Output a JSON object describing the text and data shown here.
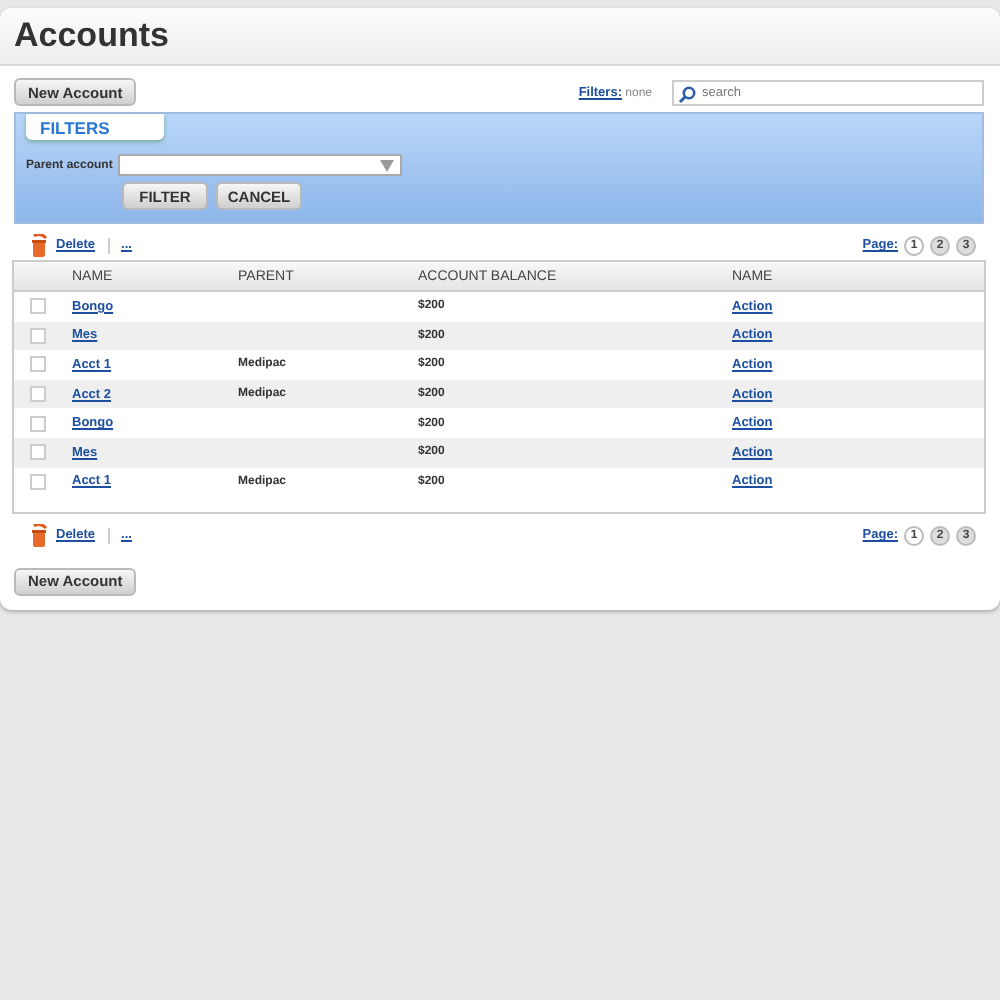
{
  "title": "Accounts",
  "new_account_button": "New Account",
  "filters_summary": {
    "label": "Filters:",
    "value": "none"
  },
  "search": {
    "placeholder": "search"
  },
  "filters_panel": {
    "title": "FILTERS",
    "parent_account_label": "Parent account",
    "buttons": [
      "FILTER",
      "CANCEL"
    ]
  },
  "top_actions": {
    "delete": "Delete",
    "more": "...",
    "page_label": "Page:",
    "pages": [
      {
        "label": "1",
        "selected": true
      },
      {
        "label": "2",
        "selected": false
      },
      {
        "label": "3",
        "selected": false
      }
    ]
  },
  "table": {
    "columns": [
      "NAME",
      "PARENT",
      "ACCOUNT BALANCE",
      "NAME"
    ],
    "rows": [
      {
        "name": "Bongo",
        "parent": "",
        "balance": "$200",
        "action": "Action",
        "checked": false
      },
      {
        "name": "Mes",
        "parent": "",
        "balance": "$200",
        "action": "Action",
        "checked": false
      },
      {
        "name": "Acct 1",
        "parent": "Medipac",
        "balance": "$200",
        "action": "Action",
        "checked": false
      },
      {
        "name": "Acct 2",
        "parent": "Medipac",
        "balance": "$200",
        "action": "Action",
        "checked": false
      },
      {
        "name": "Bongo",
        "parent": "",
        "balance": "$200",
        "action": "Action",
        "checked": false
      },
      {
        "name": "Mes",
        "parent": "",
        "balance": "$200",
        "action": "Action",
        "checked": false
      },
      {
        "name": "Acct 1",
        "parent": "Medipac",
        "balance": "$200",
        "action": "Action",
        "checked": false
      }
    ]
  },
  "bottom_actions": {
    "delete": "Delete",
    "more": "...",
    "page_label": "Page:",
    "pages": [
      {
        "label": "1",
        "selected": true
      },
      {
        "label": "2",
        "selected": false
      },
      {
        "label": "3",
        "selected": false
      }
    ]
  },
  "bottom_button": "New Account"
}
